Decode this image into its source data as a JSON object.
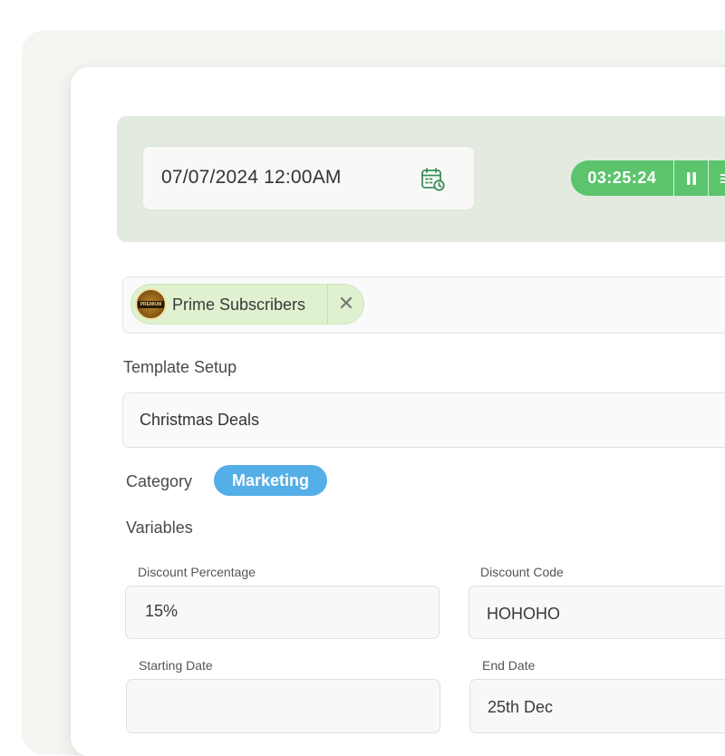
{
  "schedule": {
    "datetime_value": "07/07/2024 12:00AM",
    "calendar_icon": "calendar-clock-icon",
    "timer_value": "03:25:24",
    "pause_icon": "pause-icon",
    "menu_icon": "menu-icon"
  },
  "audience": {
    "chip_label": "Prime Subscribers",
    "chip_avatar_text": "PREMIUM",
    "remove_icon": "close-icon"
  },
  "template": {
    "section_label": "Template Setup",
    "selected_value": "Christmas Deals",
    "category_label": "Category",
    "category_value": "Marketing",
    "variables_label": "Variables"
  },
  "variables": {
    "discount_percentage": {
      "label": "Discount Percentage",
      "value": "15%"
    },
    "discount_code": {
      "label": "Discount Code",
      "value": "HOHOHO"
    },
    "starting_date": {
      "label": "Starting Date",
      "value": ""
    },
    "end_date": {
      "label": "End Date",
      "value": "25th Dec"
    }
  },
  "colors": {
    "accent_green": "#5bc46c",
    "panel_green": "#e3ebe0",
    "chip_green": "#dff1cf",
    "category_blue": "#54aee7"
  }
}
